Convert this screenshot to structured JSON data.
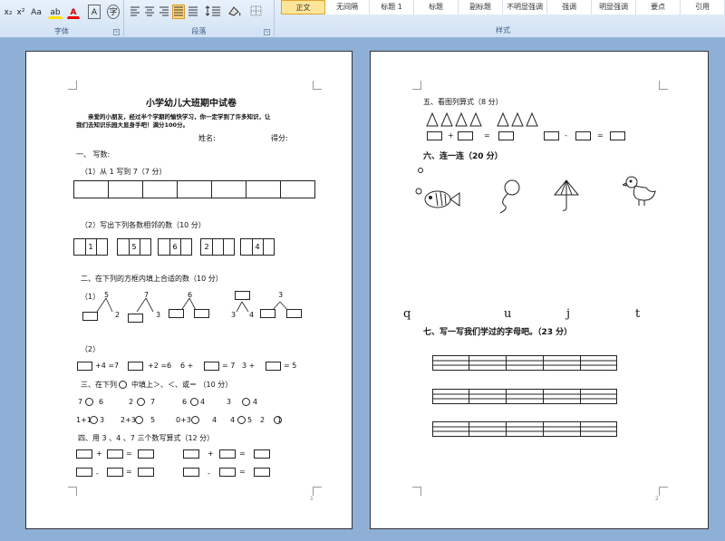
{
  "ribbon": {
    "font_group_label": "字体",
    "paragraph_group_label": "段落",
    "styles_group_label": "样式",
    "font_buttons": {
      "subscript": "x₂",
      "superscript": "x²",
      "change_case": "Aa",
      "highlight": "ab",
      "font_color": "A",
      "phonetic": "A",
      "enclose": "字"
    },
    "styles": [
      {
        "label": "正文",
        "active": true
      },
      {
        "label": "无间隔",
        "active": false
      },
      {
        "label": "标题 1",
        "active": false
      },
      {
        "label": "标题",
        "active": false
      },
      {
        "label": "副标题",
        "active": false
      },
      {
        "label": "不明显强调",
        "active": false
      },
      {
        "label": "强调",
        "active": false
      },
      {
        "label": "明显强调",
        "active": false
      },
      {
        "label": "要点",
        "active": false
      },
      {
        "label": "引用",
        "active": false
      }
    ]
  },
  "page1": {
    "title": "小学幼儿大班期中试卷",
    "intro_line1": "亲爱的小朋友，经过半个学期的愉快学习，你一定学到了许多知识，让",
    "intro_line2": "我们去知识乐园大显身手吧！满分100分。",
    "name_label": "姓名:",
    "score_label": "得分:",
    "q1": "一、 写数:",
    "q1_1": "（1）从 1 写到 7（7 分）",
    "q1_2": "（2）写出下列各数相邻的数（10 分）",
    "neighbors": [
      "1",
      "5",
      "6",
      "2",
      "4"
    ],
    "q2": "二、在下列的方框内填上合适的数（10 分）",
    "q2_1_label": "（1）",
    "split_tops": [
      "5",
      "7",
      "6",
      "",
      "3"
    ],
    "split_parts": [
      "2",
      "3",
      "",
      "3",
      "4"
    ],
    "q2_2_label": "（2）",
    "eq_row": [
      "+4 =7",
      "+2 =6",
      "6 +",
      "= 7",
      "3 +",
      "= 5"
    ],
    "q3": "三、在下列",
    "q3_tail": "中填上＞、＜、或＝ （10 分）",
    "cmp_row1": [
      "7",
      "6",
      "2",
      "7",
      "6",
      "4",
      "3",
      "4"
    ],
    "cmp_row2": [
      "1+1",
      "3",
      "2+3",
      "5",
      "0+3",
      "4",
      "4",
      "5",
      "2",
      "1"
    ],
    "q4": "四、用 3 、4 、7 三个数写算式（12 分）",
    "ops": [
      "+",
      "=",
      "+",
      "=",
      "-",
      "=",
      "-",
      "="
    ],
    "page_number": "1"
  },
  "page2": {
    "q5": "五、看图列算式（8 分）",
    "q5_ops": [
      "+",
      "=",
      "-",
      "="
    ],
    "q6": "六、连一连（20 分）",
    "letters": [
      "q",
      "u",
      "j",
      "t"
    ],
    "q7": "七、写一写我们学过的字母吧。（23 分）",
    "page_number": "2"
  }
}
